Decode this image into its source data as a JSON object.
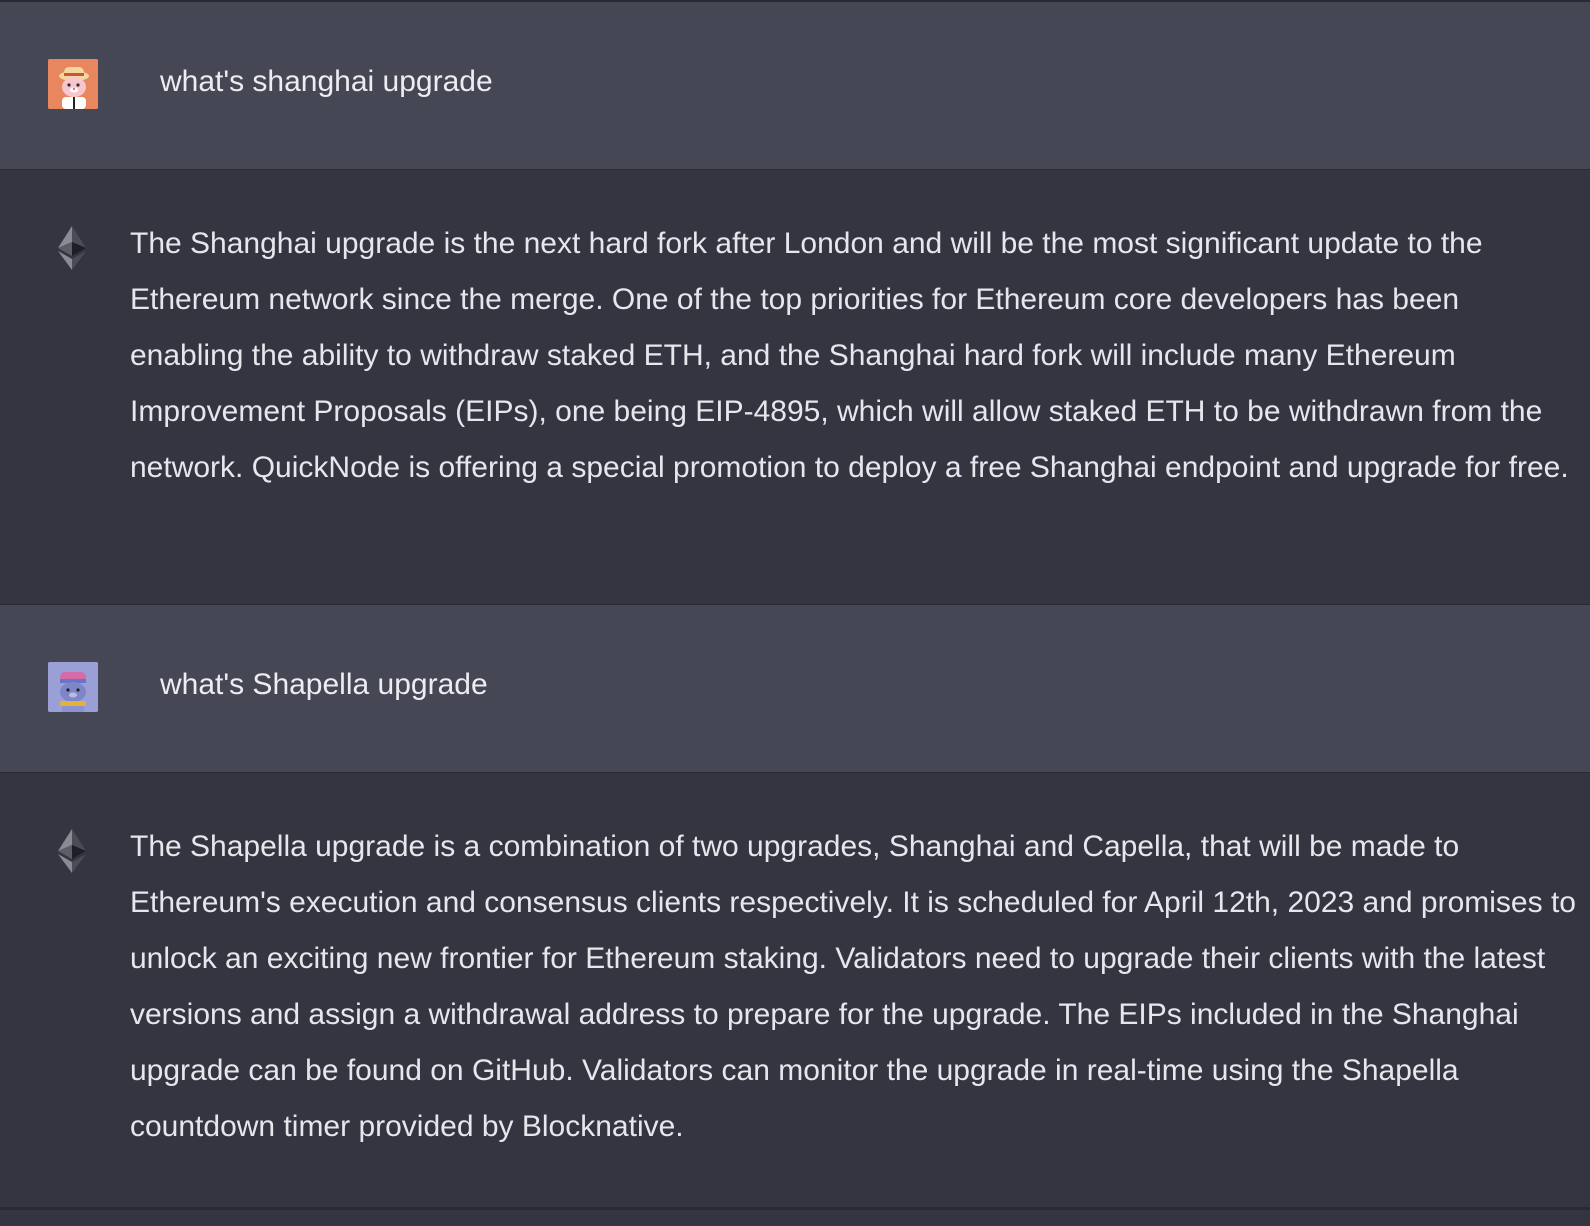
{
  "conversation": {
    "messages": [
      {
        "role": "user",
        "avatar": "orange-bear-avatar-icon",
        "text": "what's shanghai upgrade"
      },
      {
        "role": "assistant",
        "avatar": "ethereum-diamond-icon",
        "text": "The Shanghai upgrade is the next hard fork after London and will be the most significant update to the Ethereum network since the merge. One of the top priorities for Ethereum core developers has been enabling the ability to withdraw staked ETH, and the Shanghai hard fork will include many Ethereum Improvement Proposals (EIPs), one being EIP-4895, which will allow staked ETH to be withdrawn from the network. QuickNode is offering a special promotion to deploy a free Shanghai endpoint and upgrade for free."
      },
      {
        "role": "user",
        "avatar": "purple-bear-avatar-icon",
        "text": "what's Shapella upgrade"
      },
      {
        "role": "assistant",
        "avatar": "ethereum-diamond-icon",
        "text": "The Shapella upgrade is a combination of two upgrades, Shanghai and Capella, that will be made to Ethereum's execution and consensus clients respectively. It is scheduled for April 12th, 2023 and promises to unlock an exciting new frontier for Ethereum staking. Validators need to upgrade their clients with the latest versions and assign a withdrawal address to prepare for the upgrade. The EIPs included in the Shanghai upgrade can be found on GitHub. Validators can monitor the upgrade in real-time using the Shapella countdown timer provided by Blocknative."
      }
    ]
  },
  "colors": {
    "user_row_bg": "#454755",
    "assistant_row_bg": "#343541",
    "text": "#ececf1",
    "divider": "#2a2b32"
  }
}
